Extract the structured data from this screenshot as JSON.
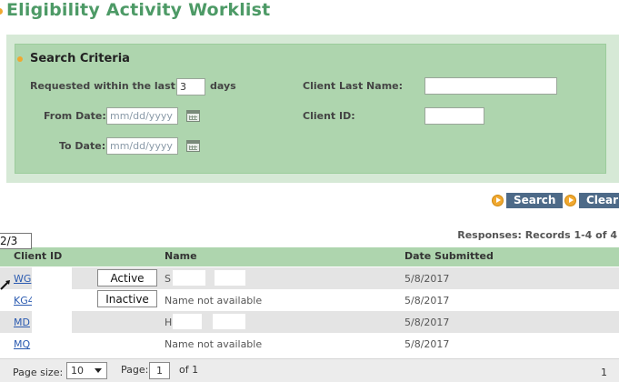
{
  "page": {
    "title": "Eligibility Activity Worklist"
  },
  "search": {
    "title": "Search Criteria",
    "requested_label": "Requested within the last",
    "requested_value": "3",
    "days_label": "days",
    "from_date_label": "From Date:",
    "to_date_label": "To Date:",
    "date_placeholder": "mm/dd/yyyy",
    "client_last_name_label": "Client Last Name:",
    "client_last_name_value": "",
    "client_id_label": "Client ID:",
    "client_id_value": ""
  },
  "actions": {
    "search_label": "Search",
    "clear_label": "Clear"
  },
  "tooltip": "2/3",
  "results": {
    "responses_text": "Responses: Records 1-4 of 4",
    "columns": [
      "Client ID",
      "Name",
      "Date Submitted"
    ],
    "rows": [
      {
        "client_id": "WG",
        "badge": "Active",
        "name": "S F",
        "date": "5/8/2017"
      },
      {
        "client_id": "KG4",
        "badge": "Inactive",
        "name": "Name not available",
        "date": "5/8/2017"
      },
      {
        "client_id": "MD",
        "badge": "",
        "name": "H J",
        "date": "5/8/2017"
      },
      {
        "client_id": "MQ",
        "badge": "",
        "name": "Name not available",
        "date": "5/8/2017"
      }
    ]
  },
  "pager": {
    "page_size_label": "Page size:",
    "page_size_value": "10",
    "page_label": "Page:",
    "page_value": "1",
    "of_label": "of 1",
    "right_count": "1"
  },
  "colors": {
    "title_green": "#4d9a66",
    "panel_green": "#aed5ae",
    "button_blue": "#4d6a88",
    "accent_orange": "#f0a830"
  }
}
